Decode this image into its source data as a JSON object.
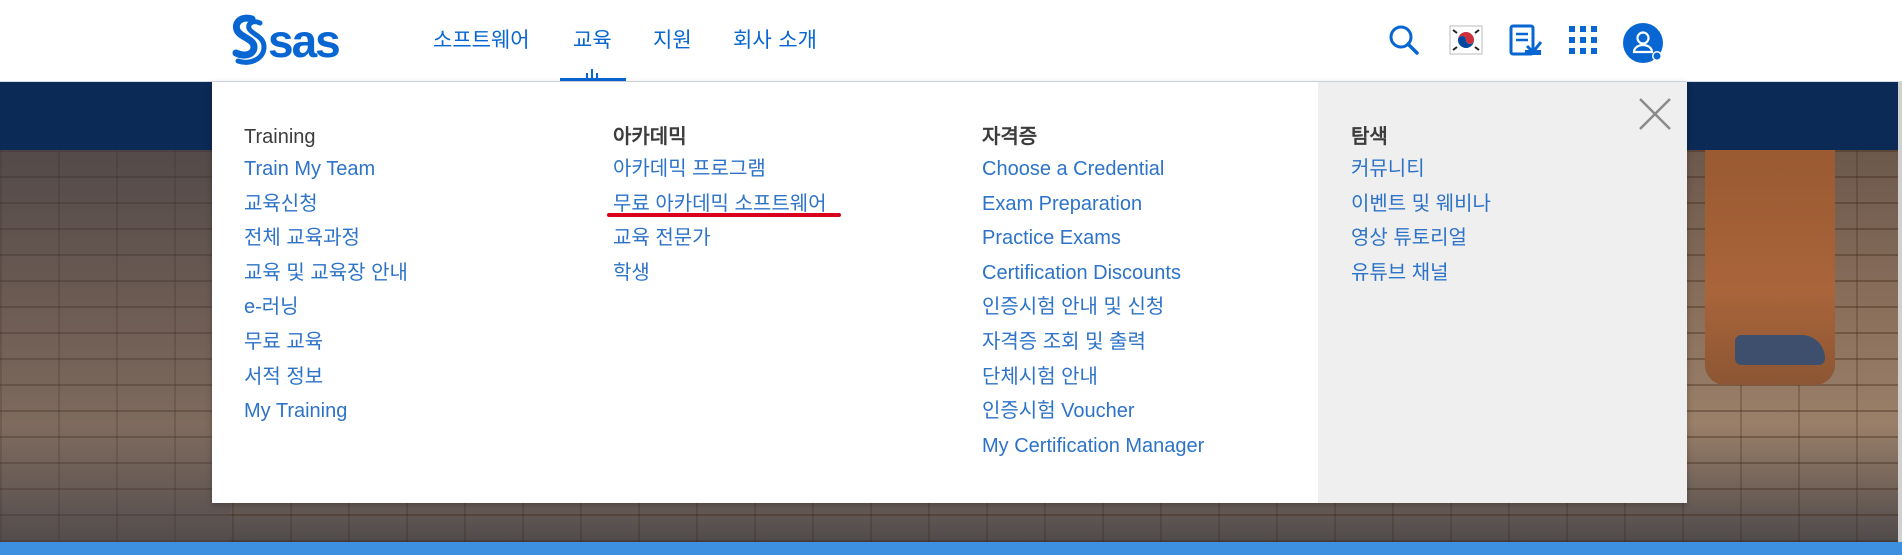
{
  "brand": {
    "logo_text": "sas",
    "accent": "#0766d1"
  },
  "nav": {
    "items": [
      {
        "label": "소프트웨어"
      },
      {
        "label": "교육",
        "active": true
      },
      {
        "label": "지원"
      },
      {
        "label": "회사 소개"
      }
    ]
  },
  "header_icons": [
    "search-icon",
    "korea-flag-icon",
    "document-download-icon",
    "apps-grid-icon",
    "user-account-icon"
  ],
  "menu": {
    "training": {
      "title": "Training",
      "links": [
        "Train My Team",
        "교육신청",
        "전체 교육과정",
        "교육 및 교육장 안내",
        "e-러닝",
        "무료 교육",
        "서적 정보",
        "My Training"
      ]
    },
    "academic": {
      "title": "아카데믹",
      "links": [
        "아카데믹 프로그램",
        "무료 아카데믹 소프트웨어",
        "교육 전문가",
        "학생"
      ]
    },
    "certification": {
      "title": "자격증",
      "links": [
        "Choose a Credential",
        "Exam Preparation",
        "Practice Exams",
        "Certification Discounts",
        "인증시험 안내 및 신청",
        "자격증 조회 및 출력",
        "단체시험 안내",
        "인증시험 Voucher",
        "My Certification Manager"
      ]
    },
    "explore": {
      "title": "탐색",
      "links": [
        "커뮤니티",
        "이벤트 및 웨비나",
        "영상 튜토리얼",
        "유튜브 채널"
      ]
    }
  },
  "colors": {
    "link": "#2d73c8",
    "heading": "#3c3c3c",
    "highlight_underline": "#d9001b",
    "hero_band": "#0c2a56",
    "bottom_strip": "#3d8fe0"
  }
}
